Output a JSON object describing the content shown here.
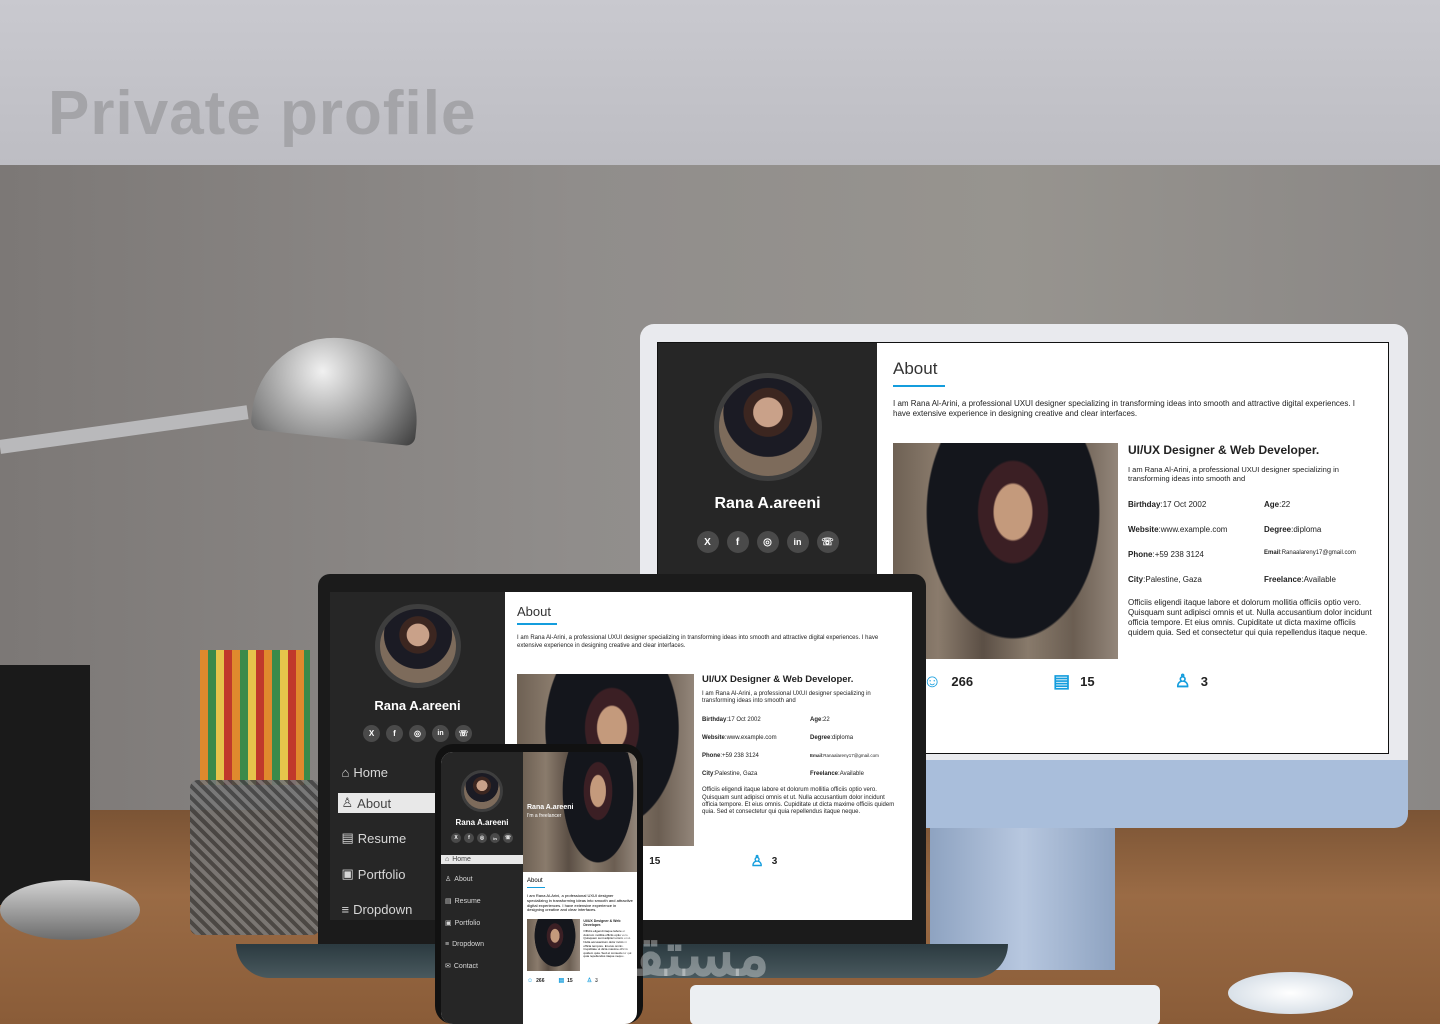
{
  "page_title": "Private profile",
  "profile": {
    "name": "Rana A.areeni",
    "tagline": "I'm a freelancer",
    "section_title": "About",
    "intro": "I am Rana Al-Arini, a professional UXUI designer specializing in transforming ideas into smooth and attractive digital experiences. I have extensive experience in designing creative and clear interfaces.",
    "role": "UI/UX Designer & Web Developer.",
    "role_text": "I am Rana Al-Arini, a professional UXUI designer specializing in transforming ideas into smooth and",
    "details": [
      {
        "label": "Birthday",
        "value": "17 Oct 2002"
      },
      {
        "label": "Age",
        "value": "22"
      },
      {
        "label": "Website",
        "value": "www.example.com"
      },
      {
        "label": "Degree",
        "value": "diploma"
      },
      {
        "label": "Phone",
        "value": "+59 238 3124"
      },
      {
        "label": "Email",
        "value": "Ranaalareny17@gmail.com"
      },
      {
        "label": "City",
        "value": "Palestine, Gaza"
      },
      {
        "label": "Freelance",
        "value": "Available"
      }
    ],
    "bio": "Officiis eligendi itaque labore et dolorum mollitia officiis optio vero. Quisquam sunt adipisci omnis et ut. Nulla accusantium dolor incidunt officia tempore. Et eius omnis. Cupiditate ut dicta maxime officiis quidem quia. Sed et consectetur qui quia repellendus itaque neque.",
    "stats": [
      {
        "value": "266",
        "icon": "smile-icon"
      },
      {
        "value": "15",
        "icon": "file-chart-icon"
      },
      {
        "value": "3",
        "icon": "award-user-icon"
      }
    ],
    "socials": [
      "X",
      "f",
      "◎",
      "in",
      "☏"
    ],
    "nav": [
      "Home",
      "About",
      "Resume",
      "Portfolio",
      "Dropdown",
      "Contact"
    ]
  },
  "watermark": "مستقل",
  "colors": {
    "accent": "#149ddd",
    "sidebar": "#262626"
  }
}
